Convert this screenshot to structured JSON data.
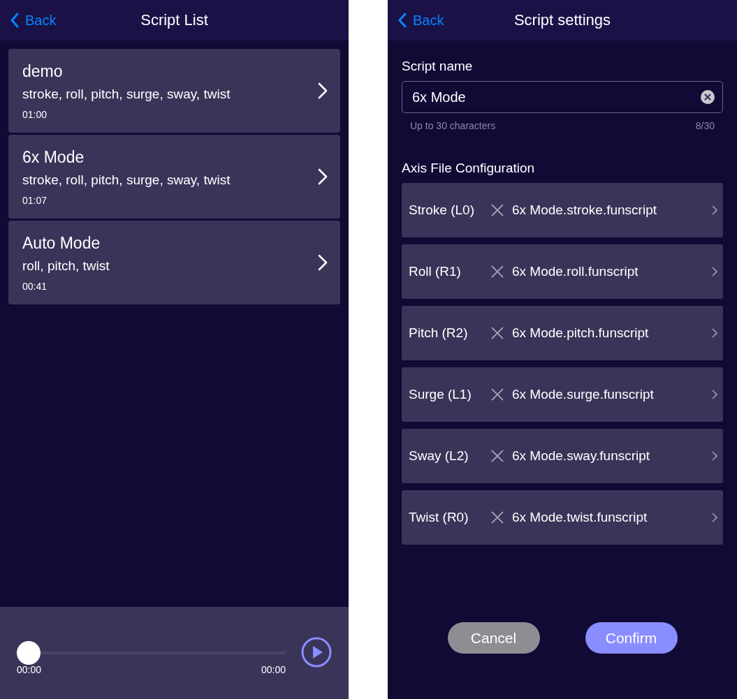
{
  "script_list": {
    "back": "Back",
    "title": "Script List",
    "scripts": [
      {
        "name": "demo",
        "axes": "stroke, roll, pitch, surge, sway, twist",
        "duration": "01:00"
      },
      {
        "name": "6x Mode",
        "axes": "stroke, roll, pitch, surge, sway, twist",
        "duration": "01:07"
      },
      {
        "name": "Auto Mode",
        "axes": "roll, pitch, twist",
        "duration": "00:41"
      }
    ],
    "player": {
      "level": 0,
      "elapsed": "00:00",
      "total": "00:00"
    }
  },
  "script_settings": {
    "back": "Back",
    "title": "Script settings",
    "name_label": "Script name",
    "name_field": {
      "value": "6x Mode"
    },
    "hint": "Up to 30 characters",
    "counter": "8/30",
    "section_title": "Axis File Configuration",
    "axes": [
      {
        "label": "Stroke (L0)",
        "file": "6x Mode.stroke.funscript"
      },
      {
        "label": "Roll (R1)",
        "file": "6x Mode.roll.funscript"
      },
      {
        "label": "Pitch (R2)",
        "file": "6x Mode.pitch.funscript"
      },
      {
        "label": "Surge (L1)",
        "file": "6x Mode.surge.funscript"
      },
      {
        "label": "Sway (L2)",
        "file": "6x Mode.sway.funscript"
      },
      {
        "label": "Twist (R0)",
        "file": "6x Mode.twist.funscript"
      }
    ],
    "buttons": [
      {
        "label": "Cancel",
        "kind": "secondary"
      },
      {
        "label": "Confirm",
        "kind": "primary"
      }
    ]
  }
}
